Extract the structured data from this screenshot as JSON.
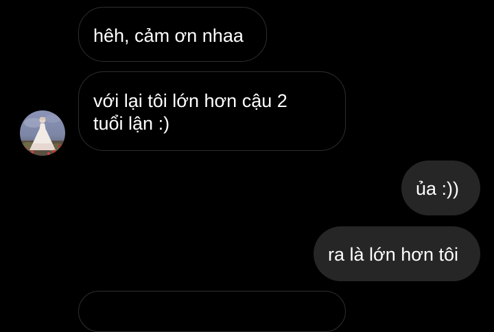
{
  "chat": {
    "messages": [
      {
        "sender": "other",
        "text": "hêh, cảm ơn nhaa"
      },
      {
        "sender": "other",
        "line1": "với lại tôi lớn hơn cậu 2",
        "line2": "tuổi lận :)"
      },
      {
        "sender": "me",
        "text": "ủa :))"
      },
      {
        "sender": "me",
        "text": "ra là lớn hơn tôi"
      }
    ]
  },
  "colors": {
    "background": "#000000",
    "incoming_bubble_border": "#2f2f2f",
    "outgoing_bubble": "#262626",
    "text": "#ffffff"
  }
}
